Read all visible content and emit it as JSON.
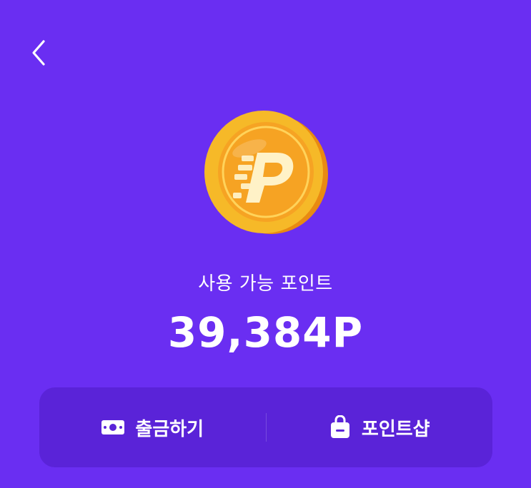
{
  "header": {
    "back_icon": "chevron-left-icon"
  },
  "points": {
    "label": "사용 가능 포인트",
    "value": "39,384P",
    "coin_icon": "points-coin-icon"
  },
  "actions": {
    "withdraw": {
      "label": "출금하기",
      "icon": "cash-icon"
    },
    "shop": {
      "label": "포인트샵",
      "icon": "shopping-bag-icon"
    }
  },
  "colors": {
    "background": "#6A2EF2",
    "action_bar": "#5A23D8",
    "coin_gold": "#F6B928",
    "coin_orange": "#F48A14"
  }
}
